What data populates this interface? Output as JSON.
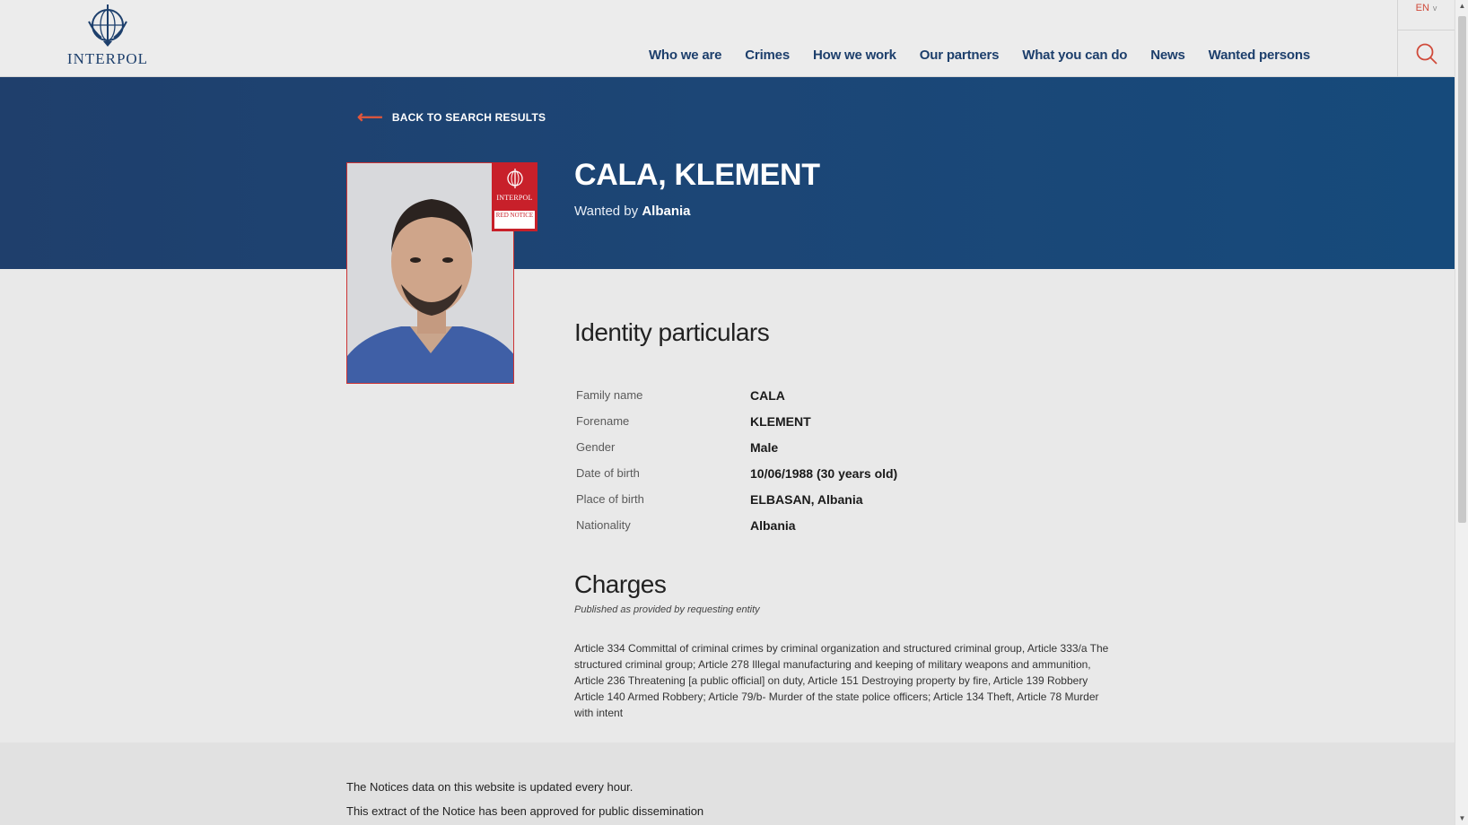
{
  "header": {
    "logo_text": "INTERPOL",
    "nav": [
      "Who we are",
      "Crimes",
      "How we work",
      "Our partners",
      "What you can do",
      "News",
      "Wanted persons"
    ],
    "language": "EN"
  },
  "hero": {
    "back_label": "BACK TO SEARCH RESULTS",
    "name": "CALA, KLEMENT",
    "wanted_prefix": "Wanted by",
    "wanted_country": "Albania",
    "badge_org": "INTERPOL",
    "badge_notice": "RED NOTICE"
  },
  "identity": {
    "title": "Identity particulars",
    "rows": [
      {
        "label": "Family name",
        "value": "CALA"
      },
      {
        "label": "Forename",
        "value": "KLEMENT"
      },
      {
        "label": "Gender",
        "value": "Male"
      },
      {
        "label": "Date of birth",
        "value": "10/06/1988 (30 years old)"
      },
      {
        "label": "Place of birth",
        "value": "ELBASAN, Albania"
      },
      {
        "label": "Nationality",
        "value": "Albania"
      }
    ]
  },
  "charges": {
    "title": "Charges",
    "subtitle": "Published as provided by requesting entity",
    "text": "Article 334 Committal of criminal crimes by criminal organization and structured criminal group, Article 333/a The structured criminal group; Article 278 Illegal manufacturing and keeping of military weapons and ammunition, Article 236 Threatening [a public official] on duty, Article 151 Destroying property by fire, Article 139 Robbery Article 140 Armed Robbery; Article 79/b- Murder of the state police officers; Article 134 Theft, Article 78 Murder with intent"
  },
  "footer": {
    "line1": "The Notices data on this website is updated every hour.",
    "line2": "This extract of the Notice has been approved for public dissemination"
  },
  "colors": {
    "hero_blue": "#1c4676",
    "nav_blue": "#1d3f6c",
    "notice_red": "#c8202a",
    "accent_orange": "#e2563b"
  }
}
